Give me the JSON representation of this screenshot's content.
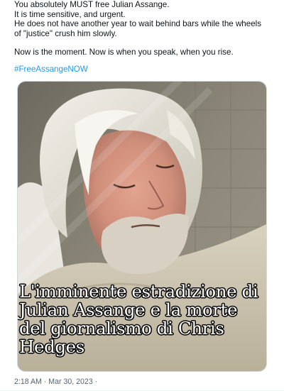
{
  "tweet": {
    "lines": [
      "You absolutely MUST free Julian Assange.",
      "It is time sensitive, and urgent.",
      "He does not have another year to wait behind bars while the wheels of \"justice\" crush him slowly.",
      "Now is the moment. Now is when you speak, when you rise."
    ],
    "hashtag": "#FreeAssangeNOW",
    "timestamp": "2:18 AM · Mar 30, 2023 ·",
    "link_color": "#1d9bf0"
  },
  "media": {
    "caption": "L'imminente estradizione di Julian Assange e la morte del giornalismo di Chris Hedges"
  }
}
